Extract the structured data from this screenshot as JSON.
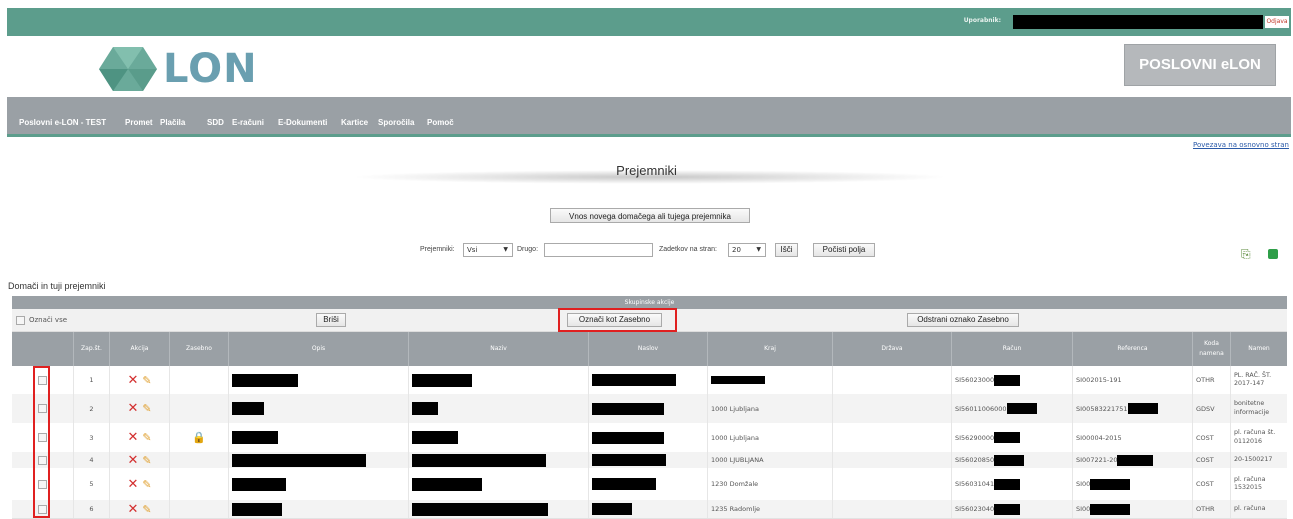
{
  "topbar": {
    "user_label": "Uporabnik:",
    "logout": "Odjava"
  },
  "logo": {
    "text": "LON"
  },
  "brand_box": "POSLOVNI eLON",
  "nav": [
    "Poslovni e-LON - TEST",
    "Promet",
    "Plačila",
    "SDD",
    "E-računi",
    "E-Dokumenti",
    "Kartice",
    "Sporočila",
    "Pomoč"
  ],
  "home_link": "Povezava na osnovno stran",
  "page_title": "Prejemniki",
  "add_button": "Vnos novega domačega ali tujega prejemnika",
  "filters": {
    "recipients_label": "Prejemniki:",
    "recipients_value": "Vsi",
    "other_label": "Drugo:",
    "per_page_label": "Zadetkov na stran:",
    "per_page_value": "20",
    "search_button": "Išči",
    "clear_button": "Počisti polja"
  },
  "section_label": "Domači in tuji prejemniki",
  "group_actions": {
    "title": "Skupinske akcije",
    "select_all": "Označi vse",
    "delete": "Briši",
    "mark_private": "Označi kot Zasebno",
    "unmark_private": "Odstrani oznako Zasebno"
  },
  "columns": [
    "Zap.št.",
    "Akcija",
    "Zasebno",
    "Opis",
    "Naziv",
    "Naslov",
    "Kraj",
    "Država",
    "Račun",
    "Referenca",
    "Koda namena",
    "Namen"
  ],
  "rows": [
    {
      "n": "1",
      "kraj": "",
      "racun": "SI56023000",
      "ref": "SI002015-191",
      "koda": "OTHR",
      "namen": "PL. RAČ. ŠT. 2017-147",
      "lock": false
    },
    {
      "n": "2",
      "kraj": "1000 Ljubljana",
      "racun": "SI56011006000",
      "ref": "SI00583221751",
      "koda": "GDSV",
      "namen": "bonitetne informacije",
      "lock": false
    },
    {
      "n": "3",
      "kraj": "1000 Ljubljana",
      "racun": "SI56290000",
      "ref": "SI00004-2015",
      "koda": "COST",
      "namen": "pl. računa št. 0112016",
      "lock": true
    },
    {
      "n": "4",
      "kraj": "1000 LJUBLJANA",
      "racun": "SI56020850",
      "ref": "SI007221-20",
      "koda": "COST",
      "namen": "20-1500217",
      "lock": false
    },
    {
      "n": "5",
      "kraj": "1230 Domžale",
      "racun": "SI56031041",
      "ref": "SI00",
      "koda": "COST",
      "namen": "pl. računa 1532015",
      "lock": false
    },
    {
      "n": "6",
      "kraj": "1235 Radomlje",
      "racun": "SI56023040",
      "ref": "SI00",
      "koda": "OTHR",
      "namen": "pl. računa",
      "lock": false
    }
  ],
  "colors": {
    "teal": "#5c9d8c",
    "grey_nav": "#9aa0a5",
    "highlight": "#e02020"
  }
}
